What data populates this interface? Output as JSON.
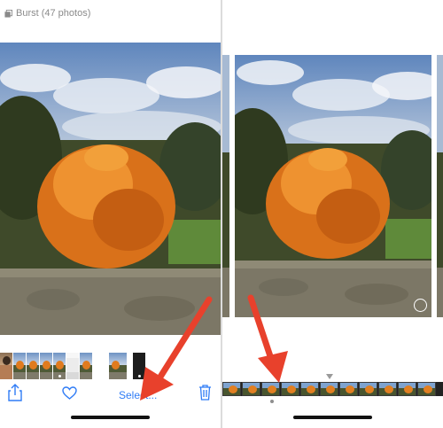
{
  "left_panel": {
    "burst_label": "Burst (47 photos)",
    "icons": {
      "burst": "burst-stack-icon",
      "share": "share-icon",
      "favorite": "heart-icon",
      "delete": "trash-icon"
    },
    "select_label": "Select...",
    "thumbnail_count": 11
  },
  "right_panel": {
    "frame_count": 11
  },
  "colors": {
    "accent_blue": "#2f7cf6",
    "annotation_red": "#e8412c",
    "tree_orange": "#e07b1f",
    "sky_blue": "#6f93c4"
  }
}
